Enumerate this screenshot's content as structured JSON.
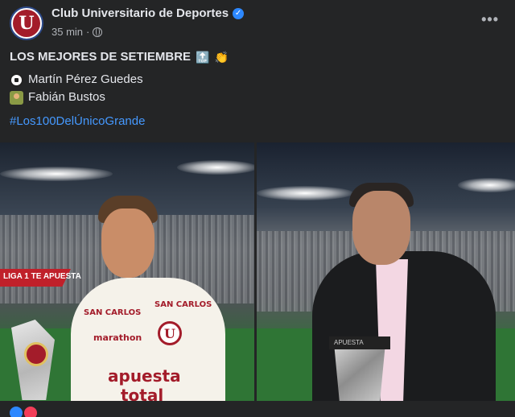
{
  "post": {
    "page_name": "Club Universitario de Deportes",
    "avatar_letter": "U",
    "time": "35 min",
    "dot": "·",
    "more": "•••",
    "title": "LOS MEJORES DE SETIEMBRE",
    "title_emoji_1": "🔝",
    "title_emoji_2": "👏",
    "lines": [
      {
        "icon": "soccer-ball-icon",
        "text": "Martín Pérez Guedes"
      },
      {
        "icon": "coach-icon",
        "text": "Fabián Bustos"
      }
    ],
    "hashtag": "#Los100DelÚnicoGrande"
  },
  "photos": {
    "left": {
      "banner": "LIGA 1 TE APUESTA",
      "shirt_logo": "U",
      "sponsor_1": "SAN CARLOS",
      "sponsor_2": "SAN CARLOS",
      "brand": "marathon",
      "sponsor_main_1": "apuesta",
      "sponsor_main_2": "total"
    },
    "right": {
      "trophy_label": "APUESTA"
    }
  },
  "colors": {
    "background": "#242526",
    "text": "#e4e6eb",
    "secondary_text": "#b0b3b8",
    "link": "#4599ff",
    "brand": "#a31c2a"
  }
}
